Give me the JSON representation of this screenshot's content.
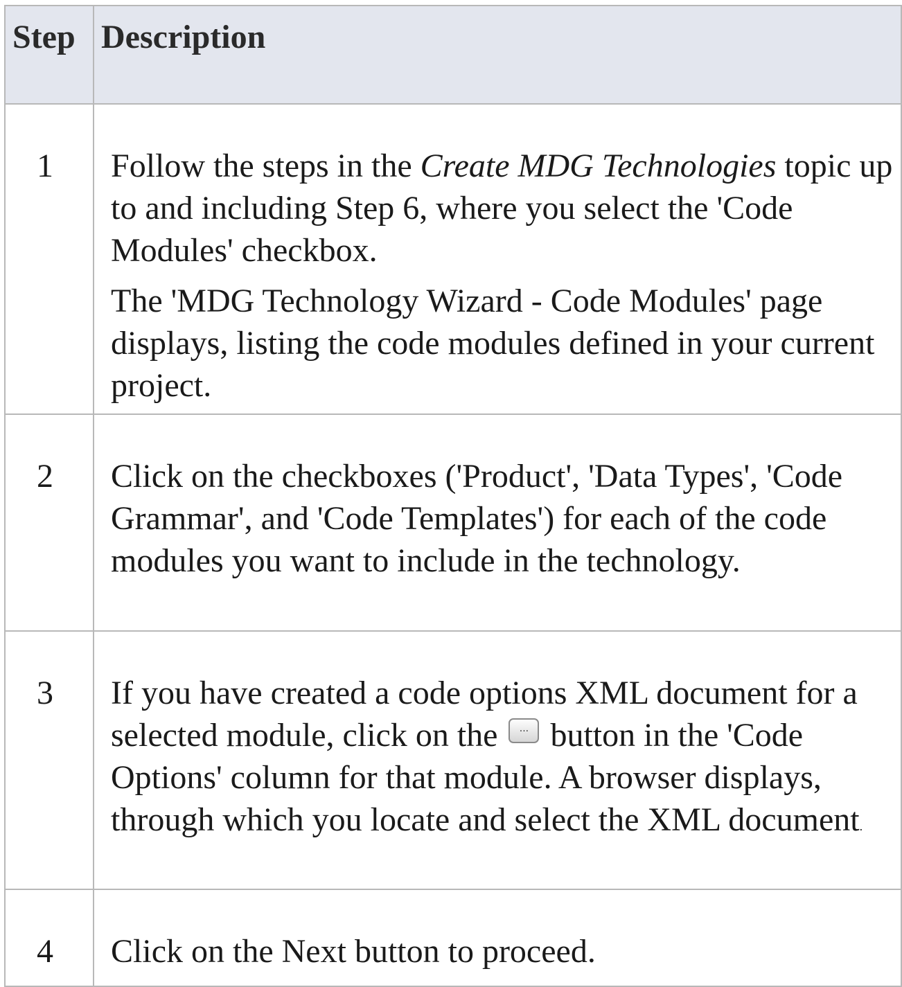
{
  "table": {
    "headers": {
      "step": "Step",
      "description": "Description"
    },
    "rows": [
      {
        "step": "1",
        "p1_a": "Follow the steps in the ",
        "p1_em": "Create MDG Technologies",
        "p1_b": " topic up to and including Step 6, where you select the 'Code Modules' checkbox.",
        "p2": "The 'MDG Technology Wizard - Code Modules' page displays, listing the code modules defined in your current project."
      },
      {
        "step": "2",
        "p1": "Click on the checkboxes ('Product', 'Data Types', 'Code Grammar', and 'Code Templates') for each of the code modules you want to include in the technology."
      },
      {
        "step": "3",
        "p1_a": "If you have created a code options XML document for a selected module, click on the",
        "button_label": "...",
        "p1_b": "button in the 'Code Options' column for that module. A browser displays, through which you locate and select the XML document",
        "p1_end": "."
      },
      {
        "step": "4",
        "p1": "Click on the Next button to proceed."
      }
    ]
  }
}
